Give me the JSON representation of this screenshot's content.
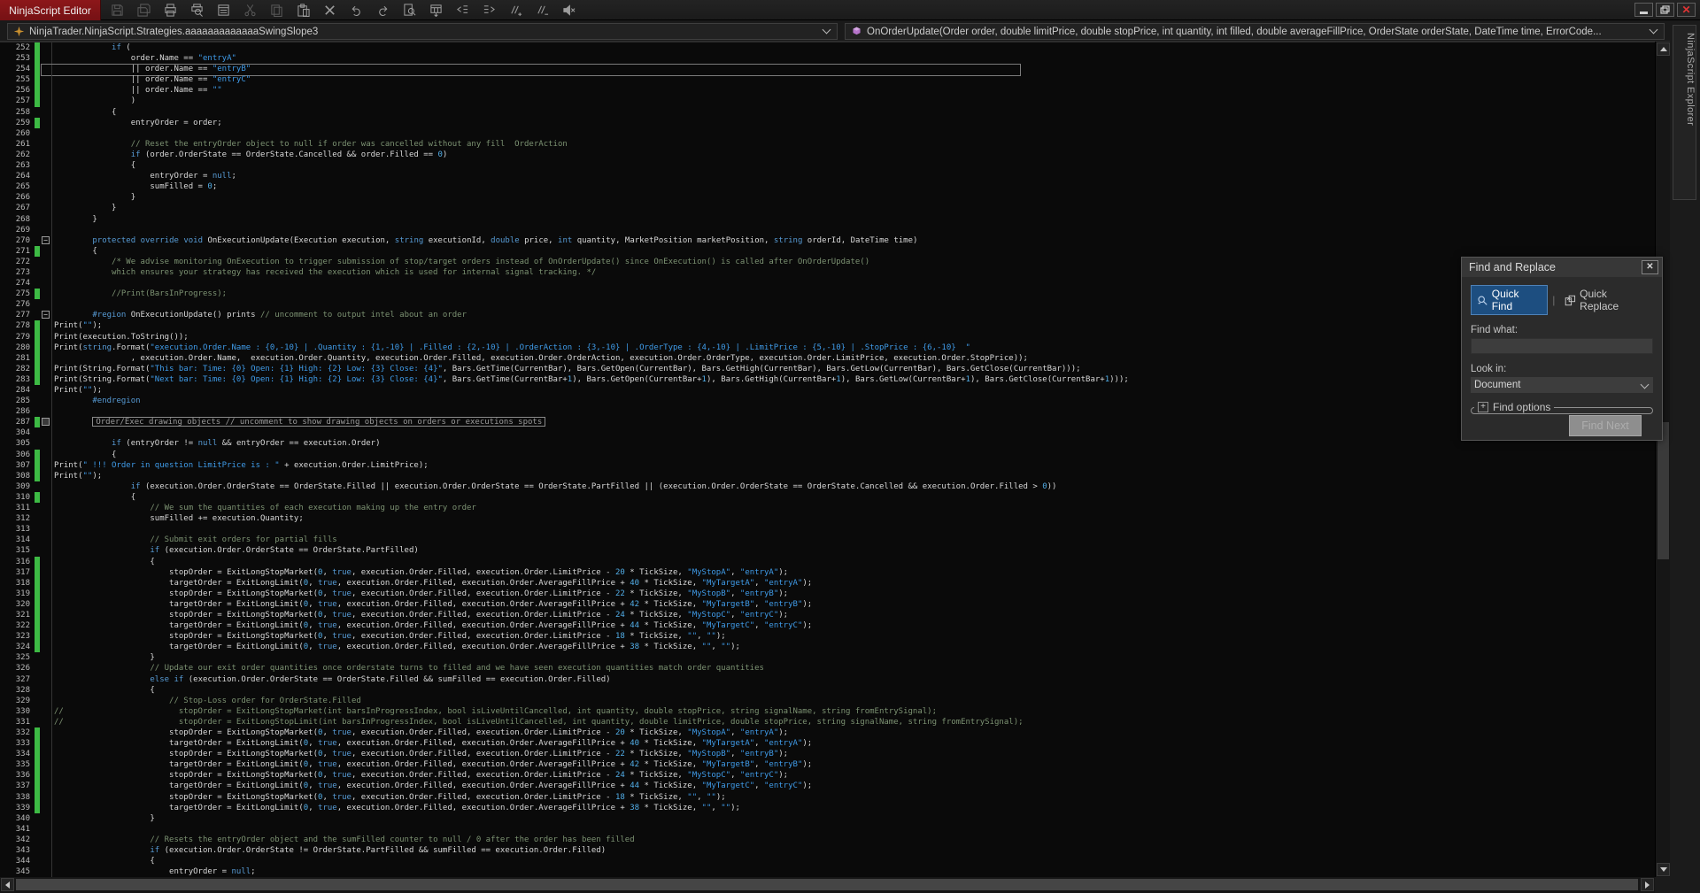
{
  "titlebar": {
    "app_tab": "NinjaScript Editor",
    "icons": [
      {
        "name": "save",
        "disabled": true
      },
      {
        "name": "save-all",
        "disabled": true
      },
      {
        "name": "print",
        "disabled": false
      },
      {
        "name": "print-preview",
        "disabled": false
      },
      {
        "name": "properties-window",
        "disabled": false
      },
      {
        "name": "cut",
        "disabled": true
      },
      {
        "name": "copy",
        "disabled": true
      },
      {
        "name": "paste",
        "disabled": false
      },
      {
        "name": "delete",
        "disabled": false
      },
      {
        "name": "undo",
        "disabled": false
      },
      {
        "name": "redo",
        "disabled": false
      },
      {
        "name": "find",
        "disabled": false
      },
      {
        "name": "compile",
        "disabled": false
      },
      {
        "name": "outdent",
        "disabled": false
      },
      {
        "name": "indent",
        "disabled": false
      },
      {
        "name": "comment",
        "disabled": false
      },
      {
        "name": "uncomment",
        "disabled": false
      },
      {
        "name": "mute",
        "disabled": false
      }
    ],
    "window_controls": [
      "minimize",
      "restore",
      "close"
    ]
  },
  "combos": {
    "left": {
      "text": "NinjaTrader.NinjaScript.Strategies.aaaaaaaaaaaaaSwingSlope3"
    },
    "right": {
      "text": "OnOrderUpdate(Order order, double limitPrice, double stopPrice, int quantity, int filled, double averageFillPrice, OrderState orderState, DateTime time, ErrorCode..."
    }
  },
  "explorer_tab": "NinjaScript Explorer",
  "colors": {
    "app_tab_red": "#8D171A",
    "change_bar_green": "#3DBA44",
    "quick_find_blue": "#1D4E80",
    "keyword": "#579BD5",
    "string": "#3F9BE8",
    "number": "#52AEE8",
    "comment": "#7C9272",
    "editor_bg": "#0A0A0A"
  },
  "editor": {
    "current_line": 254,
    "lines": [
      {
        "n": 252,
        "g": true,
        "t": "            if ("
      },
      {
        "n": 253,
        "g": true,
        "t": "                order.Name == \"entryA\""
      },
      {
        "n": 254,
        "g": true,
        "t": "                || order.Name == \"entryB\""
      },
      {
        "n": 255,
        "g": true,
        "t": "                || order.Name == \"entryC\""
      },
      {
        "n": 256,
        "g": true,
        "t": "                || order.Name == \"\""
      },
      {
        "n": 257,
        "g": true,
        "t": "                )"
      },
      {
        "n": 258,
        "t": "            {"
      },
      {
        "n": 259,
        "g": true,
        "t": "                entryOrder = order;"
      },
      {
        "n": 260,
        "t": ""
      },
      {
        "n": 261,
        "t": "                // Reset the entryOrder object to null if order was cancelled without any fill  OrderAction"
      },
      {
        "n": 262,
        "t": "                if (order.OrderState == OrderState.Cancelled && order.Filled == 0)"
      },
      {
        "n": 263,
        "t": "                {"
      },
      {
        "n": 264,
        "t": "                    entryOrder = null;"
      },
      {
        "n": 265,
        "t": "                    sumFilled = 0;"
      },
      {
        "n": 266,
        "t": "                }"
      },
      {
        "n": 267,
        "t": "            }"
      },
      {
        "n": 268,
        "t": "        }"
      },
      {
        "n": 269,
        "t": ""
      },
      {
        "n": 270,
        "fold": "minus",
        "t": "        protected override void OnExecutionUpdate(Execution execution, string executionId, double price, int quantity, MarketPosition marketPosition, string orderId, DateTime time)"
      },
      {
        "n": 271,
        "g": true,
        "t": "        {"
      },
      {
        "n": 272,
        "t": "            /* We advise monitoring OnExecution to trigger submission of stop/target orders instead of OnOrderUpdate() since OnExecution() is called after OnOrderUpdate()"
      },
      {
        "n": 273,
        "t": "            which ensures your strategy has received the execution which is used for internal signal tracking. */"
      },
      {
        "n": 274,
        "t": ""
      },
      {
        "n": 275,
        "g": true,
        "t": "            //Print(BarsInProgress);"
      },
      {
        "n": 276,
        "t": ""
      },
      {
        "n": 277,
        "fold": "minus",
        "t": "        #region OnExecutionUpdate() prints // uncomment to output intel about an order"
      },
      {
        "n": 278,
        "g": true,
        "t": "Print(\"\");"
      },
      {
        "n": 279,
        "g": true,
        "t": "Print(execution.ToString());"
      },
      {
        "n": 280,
        "g": true,
        "t": "Print(string.Format(\"execution.Order.Name : {0,-10} | .Quantity : {1,-10} | .Filled : {2,-10} | .OrderAction : {3,-10} | .OrderType : {4,-10} | .LimitPrice : {5,-10} | .StopPrice : {6,-10}  \""
      },
      {
        "n": 281,
        "g": true,
        "t": "                , execution.Order.Name,  execution.Order.Quantity, execution.Order.Filled, execution.Order.OrderAction, execution.Order.OrderType, execution.Order.LimitPrice, execution.Order.StopPrice));"
      },
      {
        "n": 282,
        "g": true,
        "t": "Print(String.Format(\"This bar: Time: {0} Open: {1} High: {2} Low: {3} Close: {4}\", Bars.GetTime(CurrentBar), Bars.GetOpen(CurrentBar), Bars.GetHigh(CurrentBar), Bars.GetLow(CurrentBar), Bars.GetClose(CurrentBar)));"
      },
      {
        "n": 283,
        "g": true,
        "t": "Print(String.Format(\"Next bar: Time: {0} Open: {1} High: {2} Low: {3} Close: {4}\", Bars.GetTime(CurrentBar+1), Bars.GetOpen(CurrentBar+1), Bars.GetHigh(CurrentBar+1), Bars.GetLow(CurrentBar+1), Bars.GetClose(CurrentBar+1)));"
      },
      {
        "n": 284,
        "t": "Print(\"\");"
      },
      {
        "n": 285,
        "t": "        #endregion"
      },
      {
        "n": 286,
        "t": ""
      },
      {
        "n": 287,
        "g": true,
        "fold": "plus",
        "kind": "collapsed",
        "indent": 8,
        "t": "Order/Exec drawing objects // uncomment to show drawing objects on orders or executions spots"
      },
      {
        "n": 304,
        "t": ""
      },
      {
        "n": 305,
        "t": "            if (entryOrder != null && entryOrder == execution.Order)"
      },
      {
        "n": 306,
        "g": true,
        "t": "            {"
      },
      {
        "n": 307,
        "g": true,
        "t": "Print(\" !!! Order in question LimitPrice is : \" + execution.Order.LimitPrice);"
      },
      {
        "n": 308,
        "g": true,
        "t": "Print(\"\");"
      },
      {
        "n": 309,
        "t": "                if (execution.Order.OrderState == OrderState.Filled || execution.Order.OrderState == OrderState.PartFilled || (execution.Order.OrderState == OrderState.Cancelled && execution.Order.Filled > 0))"
      },
      {
        "n": 310,
        "g": true,
        "t": "                {"
      },
      {
        "n": 311,
        "t": "                    // We sum the quantities of each execution making up the entry order"
      },
      {
        "n": 312,
        "t": "                    sumFilled += execution.Quantity;"
      },
      {
        "n": 313,
        "t": ""
      },
      {
        "n": 314,
        "t": "                    // Submit exit orders for partial fills"
      },
      {
        "n": 315,
        "t": "                    if (execution.Order.OrderState == OrderState.PartFilled)"
      },
      {
        "n": 316,
        "g": true,
        "t": "                    {"
      },
      {
        "n": 317,
        "g": true,
        "t": "                        stopOrder = ExitLongStopMarket(0, true, execution.Order.Filled, execution.Order.LimitPrice - 20 * TickSize, \"MyStopA\", \"entryA\");"
      },
      {
        "n": 318,
        "g": true,
        "t": "                        targetOrder = ExitLongLimit(0, true, execution.Order.Filled, execution.Order.AverageFillPrice + 40 * TickSize, \"MyTargetA\", \"entryA\");"
      },
      {
        "n": 319,
        "g": true,
        "t": "                        stopOrder = ExitLongStopMarket(0, true, execution.Order.Filled, execution.Order.LimitPrice - 22 * TickSize, \"MyStopB\", \"entryB\");"
      },
      {
        "n": 320,
        "g": true,
        "t": "                        targetOrder = ExitLongLimit(0, true, execution.Order.Filled, execution.Order.AverageFillPrice + 42 * TickSize, \"MyTargetB\", \"entryB\");"
      },
      {
        "n": 321,
        "g": true,
        "t": "                        stopOrder = ExitLongStopMarket(0, true, execution.Order.Filled, execution.Order.LimitPrice - 24 * TickSize, \"MyStopC\", \"entryC\");"
      },
      {
        "n": 322,
        "g": true,
        "t": "                        targetOrder = ExitLongLimit(0, true, execution.Order.Filled, execution.Order.AverageFillPrice + 44 * TickSize, \"MyTargetC\", \"entryC\");"
      },
      {
        "n": 323,
        "g": true,
        "t": "                        stopOrder = ExitLongStopMarket(0, true, execution.Order.Filled, execution.Order.LimitPrice - 18 * TickSize, \"\", \"\");"
      },
      {
        "n": 324,
        "g": true,
        "t": "                        targetOrder = ExitLongLimit(0, true, execution.Order.Filled, execution.Order.AverageFillPrice + 38 * TickSize, \"\", \"\");"
      },
      {
        "n": 325,
        "t": "                    }"
      },
      {
        "n": 326,
        "t": "                    // Update our exit order quantities once orderstate turns to filled and we have seen execution quantities match order quantities"
      },
      {
        "n": 327,
        "t": "                    else if (execution.Order.OrderState == OrderState.Filled && sumFilled == execution.Order.Filled)"
      },
      {
        "n": 328,
        "t": "                    {"
      },
      {
        "n": 329,
        "t": "                        // Stop-Loss order for OrderState.Filled"
      },
      {
        "n": 330,
        "t": "//                        stopOrder = ExitLongStopMarket(int barsInProgressIndex, bool isLiveUntilCancelled, int quantity, double stopPrice, string signalName, string fromEntrySignal);"
      },
      {
        "n": 331,
        "t": "//                        stopOrder = ExitLongStopLimit(int barsInProgressIndex, bool isLiveUntilCancelled, int quantity, double limitPrice, double stopPrice, string signalName, string fromEntrySignal);"
      },
      {
        "n": 332,
        "g": true,
        "t": "                        stopOrder = ExitLongStopMarket(0, true, execution.Order.Filled, execution.Order.LimitPrice - 20 * TickSize, \"MyStopA\", \"entryA\");"
      },
      {
        "n": 333,
        "g": true,
        "t": "                        targetOrder = ExitLongLimit(0, true, execution.Order.Filled, execution.Order.AverageFillPrice + 40 * TickSize, \"MyTargetA\", \"entryA\");"
      },
      {
        "n": 334,
        "g": true,
        "t": "                        stopOrder = ExitLongStopMarket(0, true, execution.Order.Filled, execution.Order.LimitPrice - 22 * TickSize, \"MyStopB\", \"entryB\");"
      },
      {
        "n": 335,
        "g": true,
        "t": "                        targetOrder = ExitLongLimit(0, true, execution.Order.Filled, execution.Order.AverageFillPrice + 42 * TickSize, \"MyTargetB\", \"entryB\");"
      },
      {
        "n": 336,
        "g": true,
        "t": "                        stopOrder = ExitLongStopMarket(0, true, execution.Order.Filled, execution.Order.LimitPrice - 24 * TickSize, \"MyStopC\", \"entryC\");"
      },
      {
        "n": 337,
        "g": true,
        "t": "                        targetOrder = ExitLongLimit(0, true, execution.Order.Filled, execution.Order.AverageFillPrice + 44 * TickSize, \"MyTargetC\", \"entryC\");"
      },
      {
        "n": 338,
        "g": true,
        "t": "                        stopOrder = ExitLongStopMarket(0, true, execution.Order.Filled, execution.Order.LimitPrice - 18 * TickSize, \"\", \"\");"
      },
      {
        "n": 339,
        "g": true,
        "t": "                        targetOrder = ExitLongLimit(0, true, execution.Order.Filled, execution.Order.AverageFillPrice + 38 * TickSize, \"\", \"\");"
      },
      {
        "n": 340,
        "t": "                    }"
      },
      {
        "n": 341,
        "t": ""
      },
      {
        "n": 342,
        "t": "                    // Resets the entryOrder object and the sumFilled counter to null / 0 after the order has been filled"
      },
      {
        "n": 343,
        "t": "                    if (execution.Order.OrderState != OrderState.PartFilled && sumFilled == execution.Order.Filled)"
      },
      {
        "n": 344,
        "t": "                    {"
      },
      {
        "n": 345,
        "t": "                        entryOrder = null;"
      }
    ]
  },
  "find_dialog": {
    "title": "Find and Replace",
    "close_icon": "X",
    "tabs": [
      "Quick Find",
      "Quick Replace"
    ],
    "active_tab": "Quick Find",
    "find_what_label": "Find what:",
    "find_what_value": "",
    "look_in_label": "Look in:",
    "look_in_value": "Document",
    "options_toggle": "+",
    "options_label": "Find options",
    "find_next_label": "Find Next"
  }
}
